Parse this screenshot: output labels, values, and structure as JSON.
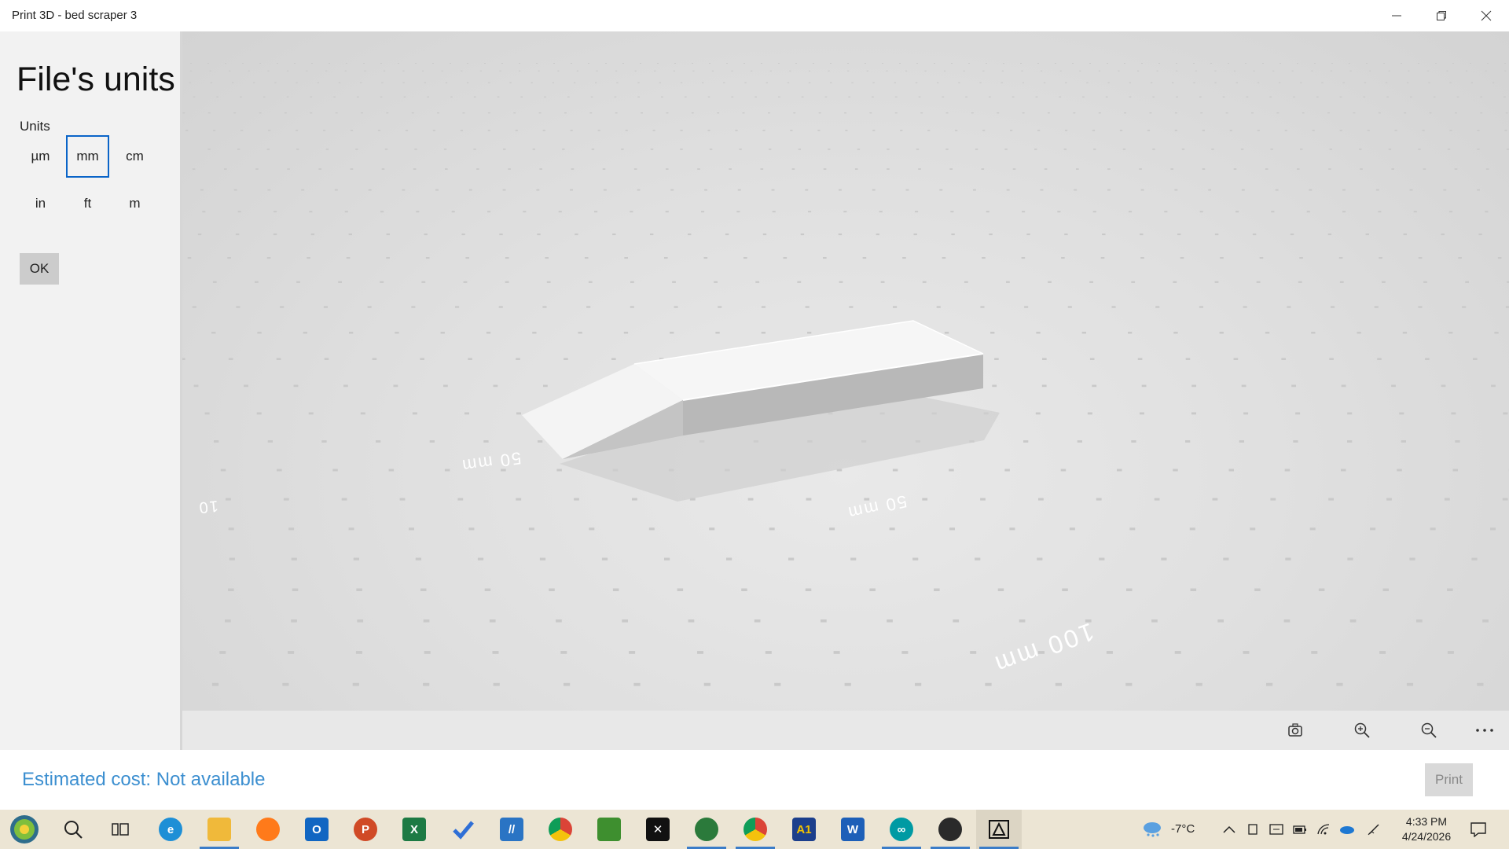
{
  "window": {
    "title": "Print 3D - bed scraper 3"
  },
  "panel": {
    "heading": "File's units",
    "units_label": "Units",
    "units": [
      "µm",
      "mm",
      "cm",
      "in",
      "ft",
      "m"
    ],
    "selected_unit": "mm",
    "ok_label": "OK"
  },
  "viewport": {
    "scale_labels": [
      "50 mm",
      "50 mm",
      "100 mm",
      "10"
    ],
    "toolbar_icons": [
      "reset-view-icon",
      "zoom-in-icon",
      "zoom-out-icon",
      "more-icon"
    ]
  },
  "status": {
    "cost_text": "Estimated cost: Not available",
    "print_label": "Print"
  },
  "taskbar": {
    "weather_temp": "-7°C",
    "time": "4:33 PM",
    "date": "4/24/2026",
    "apps": [
      "start",
      "search",
      "task-view",
      "edge",
      "file-explorer",
      "firefox",
      "outlook",
      "powerpoint",
      "excel",
      "todo",
      "azure-data-studio",
      "chrome",
      "minecraft",
      "app-x",
      "chrome-profile",
      "chrome-alt",
      "a1-app",
      "word",
      "arduino",
      "snip-app",
      "print-3d"
    ]
  },
  "colors": {
    "accent": "#0a64c8",
    "cost_text": "#3c8fd0",
    "taskbar": "#ece5d4"
  }
}
